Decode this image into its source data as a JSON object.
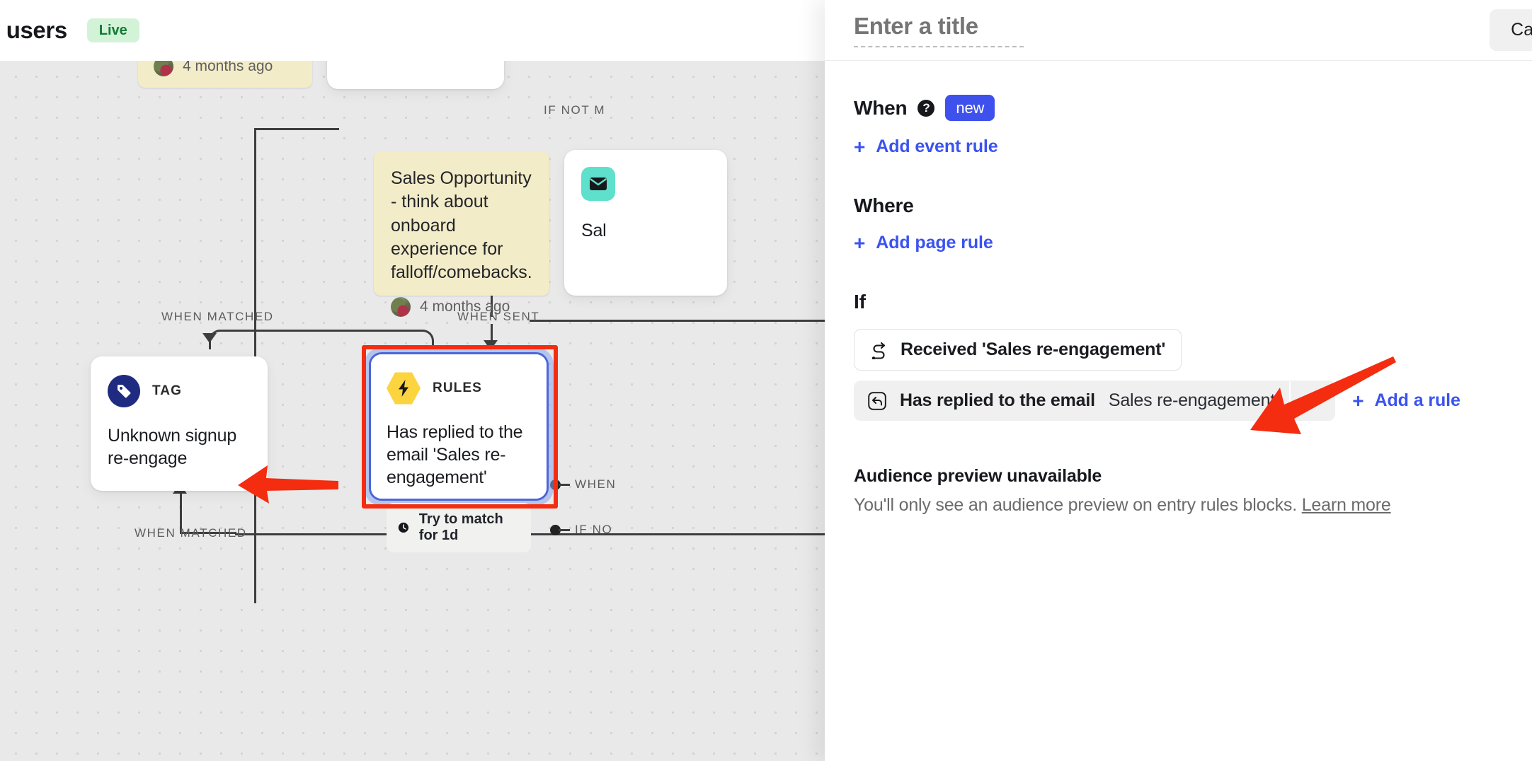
{
  "header": {
    "flow_title": "v users",
    "status_badge": "Live"
  },
  "canvas": {
    "sticky_notes": [
      {
        "name": "sticky-top-partial",
        "text": "",
        "meta": "4 months ago"
      },
      {
        "name": "sticky-sales-opportunity",
        "text": "Sales Opportunity - think about onboard experience for falloff/comebacks.",
        "meta": "4 months ago"
      }
    ],
    "nodes": [
      {
        "kind": "TAG",
        "title": "Unknown signup re-engage",
        "icon": "tag-icon"
      },
      {
        "kind": "RULES",
        "title": "Has replied to the email 'Sales re-engagement'",
        "icon": "lightning-icon",
        "footer": "Try to match for 1d",
        "footer_icon": "clock-icon"
      },
      {
        "kind": "EMAIL",
        "title": "Sal",
        "icon": "envelope-icon"
      }
    ],
    "edge_labels": {
      "if_not_matched_top": "IF NOT M",
      "when_matched_mid": "WHEN MATCHED",
      "when_sent": "WHEN SENT",
      "when_right": "WHEN",
      "if_not_right": "IF NO",
      "when_matched_bottom": "WHEN MATCHED"
    }
  },
  "panel": {
    "title_placeholder": "Enter a title",
    "title_value": "",
    "cancel_label": "Cancel",
    "when": {
      "label": "When",
      "help_icon": "question-mark-icon",
      "badge": "new",
      "add_label": "Add event rule",
      "plus": "+"
    },
    "where": {
      "label": "Where",
      "add_label": "Add page rule",
      "plus": "+"
    },
    "if": {
      "label": "If",
      "rule1": {
        "icon": "workflow-shuffle-icon",
        "text": "Received 'Sales re-engagement'"
      },
      "rule2": {
        "icon": "reply-arrow-icon",
        "label": "Has replied to the email",
        "value": "Sales re-engagement",
        "plus": "+"
      },
      "add_rule_label": "Add a rule",
      "add_rule_plus": "+"
    },
    "audience": {
      "heading": "Audience preview unavailable",
      "body": "You'll only see an audience preview on entry rules blocks.",
      "link": "Learn more"
    }
  },
  "colors": {
    "accent_blue": "#3b53ef",
    "annotation_red": "#f42c10",
    "live_green": "#127b33",
    "rules_yellow": "#fcd440",
    "tag_navy": "#1f2b80",
    "email_teal": "#5ee0cd"
  }
}
